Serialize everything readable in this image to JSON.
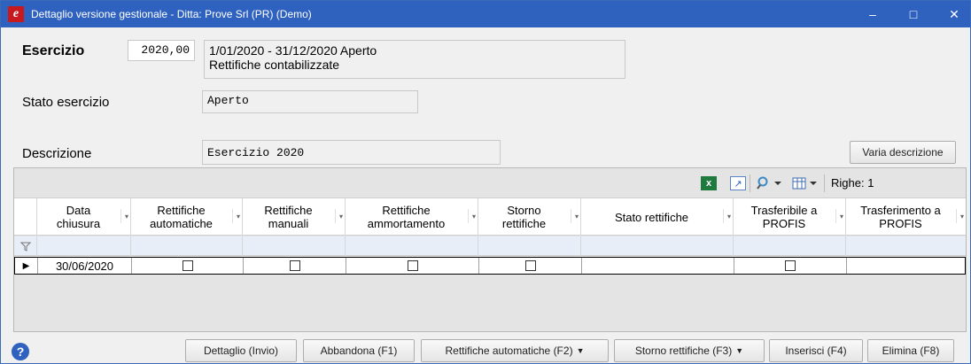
{
  "window": {
    "title": "Dettaglio versione gestionale - Ditta: Prove Srl (PR)  (Demo)",
    "minimize": "–",
    "maximize": "□",
    "close": "✕"
  },
  "esercizio": {
    "label": "Esercizio",
    "value": "2020,00",
    "info_line1": "1/01/2020 - 31/12/2020 Aperto",
    "info_line2": "Rettifiche contabilizzate"
  },
  "stato": {
    "label": "Stato esercizio",
    "value": "Aperto"
  },
  "descrizione": {
    "label": "Descrizione",
    "value": "Esercizio 2020",
    "button": "Varia descrizione"
  },
  "grid_toolbar": {
    "righe_label": "Righe: 1"
  },
  "grid": {
    "columns": [
      "Data chiusura",
      "Rettifiche automatiche",
      "Rettifiche manuali",
      "Rettifiche ammortamento",
      "Storno rettifiche",
      "Stato rettifiche",
      "Trasferibile a PROFIS",
      "Trasferimento a PROFIS"
    ],
    "rows": [
      {
        "data_chiusura": "30/06/2020",
        "rettifiche_automatiche": false,
        "rettifiche_manuali": false,
        "rettifiche_ammortamento": false,
        "storno_rettifiche": false,
        "stato_rettifiche": "",
        "trasferibile_profis": false,
        "trasferimento_profis": ""
      }
    ]
  },
  "buttons": {
    "dettaglio": "Dettaglio (Invio)",
    "abbandona": "Abbandona (F1)",
    "rettifiche_automatiche": "Rettifiche automatiche (F2)",
    "storno_rettifiche": "Storno rettifiche (F3)",
    "inserisci": "Inserisci (F4)",
    "elimina": "Elimina (F8)"
  },
  "icons": {
    "help": "help-icon",
    "excel": "excel-icon",
    "export": "export-icon",
    "search": "search-icon",
    "columns": "columns-icon"
  }
}
